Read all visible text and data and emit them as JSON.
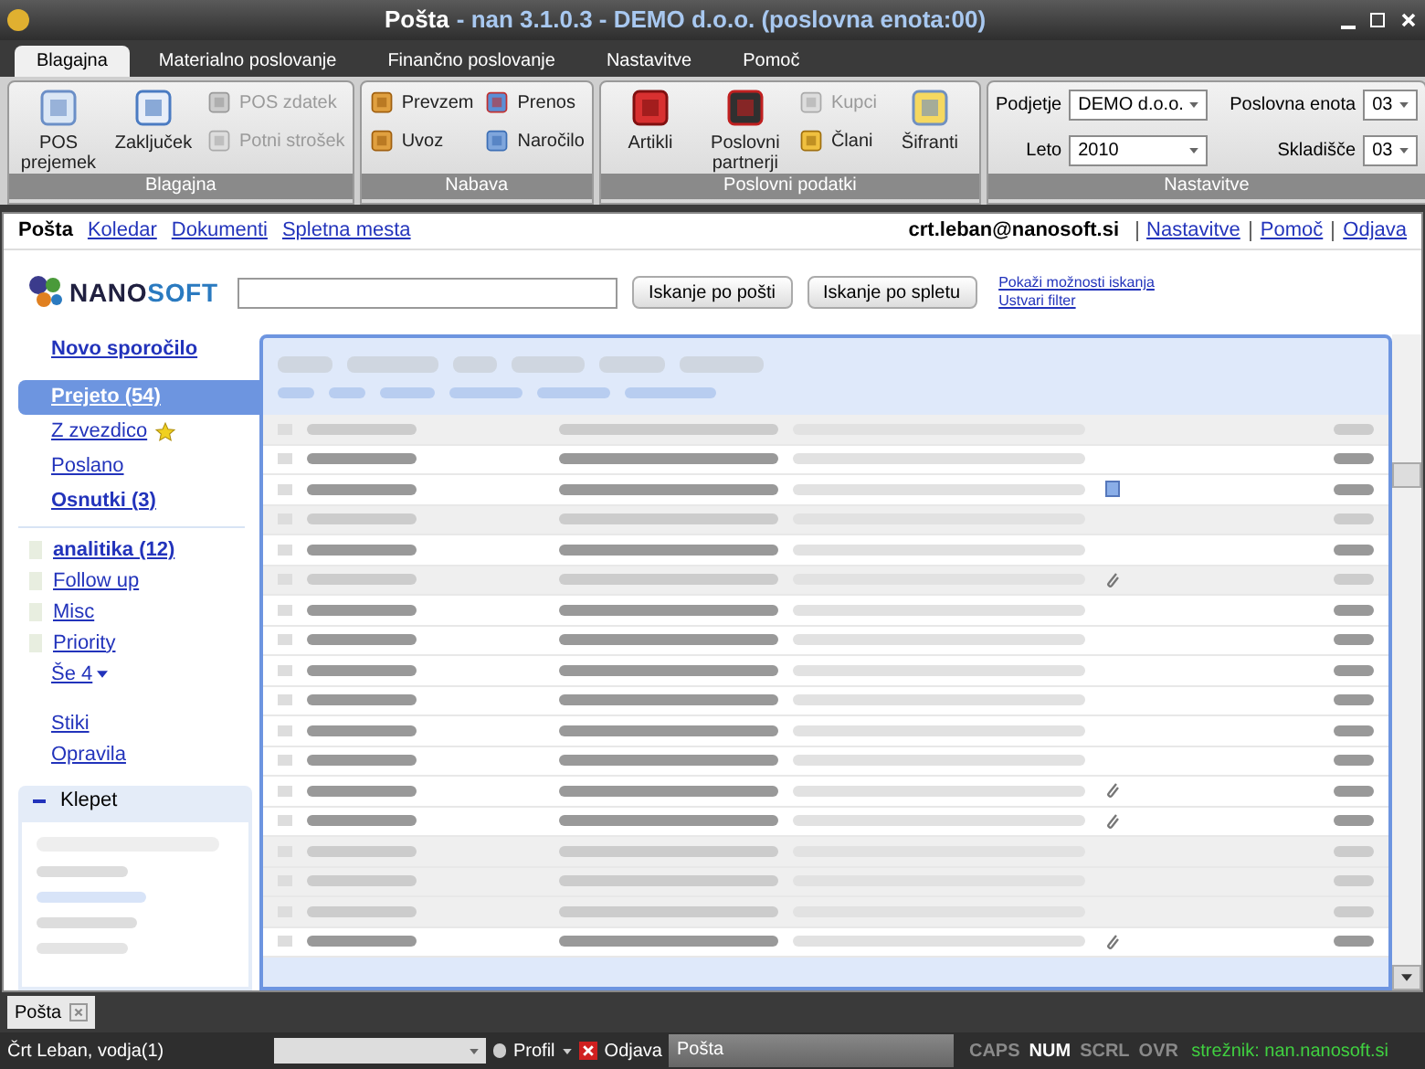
{
  "window": {
    "title": "Pošta",
    "subtitle": "- nan 3.1.0.3 - DEMO d.o.o. (poslovna enota:00)"
  },
  "ribbon_tabs": [
    {
      "label": "Blagajna",
      "selected": true
    },
    {
      "label": "Materialno poslovanje",
      "selected": false
    },
    {
      "label": "Finančno poslovanje",
      "selected": false
    },
    {
      "label": "Nastavitve",
      "selected": false
    },
    {
      "label": "Pomoč",
      "selected": false
    }
  ],
  "ribbon_groups": [
    {
      "title": "Blagajna",
      "items": [
        {
          "label": "POS prejemek",
          "kind": "large",
          "disabled": false
        },
        {
          "label": "Zaključek",
          "kind": "large",
          "disabled": false
        },
        {
          "label": "POS zdatek",
          "kind": "small",
          "disabled": true
        },
        {
          "label": "Potni strošek",
          "kind": "small",
          "disabled": true
        }
      ]
    },
    {
      "title": "Nabava",
      "items": [
        {
          "label": "Prevzem",
          "kind": "small",
          "disabled": false
        },
        {
          "label": "Uvoz",
          "kind": "small",
          "disabled": false
        },
        {
          "label": "Prenos",
          "kind": "small",
          "disabled": false
        },
        {
          "label": "Naročilo",
          "kind": "small",
          "disabled": false
        }
      ]
    },
    {
      "title": "Poslovni podatki",
      "items": [
        {
          "label": "Artikli",
          "kind": "large",
          "disabled": false
        },
        {
          "label": "Poslovni partnerji",
          "kind": "large",
          "disabled": false
        },
        {
          "label": "Kupci",
          "kind": "small",
          "disabled": true
        },
        {
          "label": "Člani",
          "kind": "small",
          "disabled": false
        },
        {
          "label": "Šifranti",
          "kind": "large",
          "disabled": false
        }
      ]
    }
  ],
  "settings_group": {
    "title": "Nastavitve",
    "fields": [
      {
        "label": "Podjetje",
        "value": "DEMO d.o.o."
      },
      {
        "label": "Poslovna enota",
        "value": "03"
      },
      {
        "label": "Leto",
        "value": "2010"
      },
      {
        "label": "Skladišče",
        "value": "03"
      }
    ]
  },
  "top_links": [
    {
      "label": "Pošta",
      "selected": true
    },
    {
      "label": "Koledar",
      "selected": false
    },
    {
      "label": "Dokumenti",
      "selected": false
    },
    {
      "label": "Spletna mesta",
      "selected": false
    }
  ],
  "user_email": "crt.leban@nanosoft.si",
  "account_links": [
    "Nastavitve",
    "Pomoč",
    "Odjava"
  ],
  "logo": {
    "part_1": "NANO",
    "part_2": "SOFT"
  },
  "search": {
    "buttons": [
      "Iskanje po pošti",
      "Iskanje po spletu"
    ],
    "links": [
      "Pokaži možnosti iskanja",
      "Ustvari filter"
    ]
  },
  "sidebar": {
    "compose": "Novo sporočilo",
    "folders": [
      {
        "label": "Prejeto (54)",
        "selected": true,
        "bold": true,
        "starred": false
      },
      {
        "label": "Z zvezdico",
        "selected": false,
        "bold": false,
        "starred": true
      },
      {
        "label": "Poslano",
        "selected": false,
        "bold": false,
        "starred": false
      },
      {
        "label": "Osnutki (3)",
        "selected": false,
        "bold": true,
        "starred": false
      }
    ],
    "labels": [
      {
        "label": "analitika (12)",
        "bold": true
      },
      {
        "label": "Follow up",
        "bold": false
      },
      {
        "label": "Misc",
        "bold": false
      },
      {
        "label": "Priority",
        "bold": false
      }
    ],
    "more": "Še 4",
    "links": [
      "Stiki",
      "Opravila"
    ],
    "chat": {
      "title": "Klepet",
      "expanded": true
    }
  },
  "mail_rows": [
    {
      "unread": false,
      "kind": "plain"
    },
    {
      "unread": true,
      "kind": "plain"
    },
    {
      "unread": true,
      "kind": "calendar"
    },
    {
      "unread": false,
      "kind": "plain"
    },
    {
      "unread": true,
      "kind": "plain"
    },
    {
      "unread": false,
      "kind": "attachment"
    },
    {
      "unread": true,
      "kind": "plain"
    },
    {
      "unread": true,
      "kind": "plain"
    },
    {
      "unread": true,
      "kind": "plain"
    },
    {
      "unread": true,
      "kind": "plain"
    },
    {
      "unread": true,
      "kind": "plain"
    },
    {
      "unread": true,
      "kind": "plain"
    },
    {
      "unread": true,
      "kind": "attachment"
    },
    {
      "unread": true,
      "kind": "attachment"
    },
    {
      "unread": false,
      "kind": "plain"
    },
    {
      "unread": false,
      "kind": "plain"
    },
    {
      "unread": false,
      "kind": "plain"
    },
    {
      "unread": true,
      "kind": "attachment"
    }
  ],
  "doc_tabs": [
    {
      "label": "Pošta"
    }
  ],
  "status_bar": {
    "user": "Črt Leban, vodja(1)",
    "profile": "Profil",
    "logout": "Odjava",
    "field": "Pošta",
    "indicators": [
      {
        "label": "CAPS",
        "on": false
      },
      {
        "label": "NUM",
        "on": true
      },
      {
        "label": "SCRL",
        "on": false
      },
      {
        "label": "OVR",
        "on": false
      }
    ],
    "server": "strežnik: nan.nanosoft.si"
  }
}
